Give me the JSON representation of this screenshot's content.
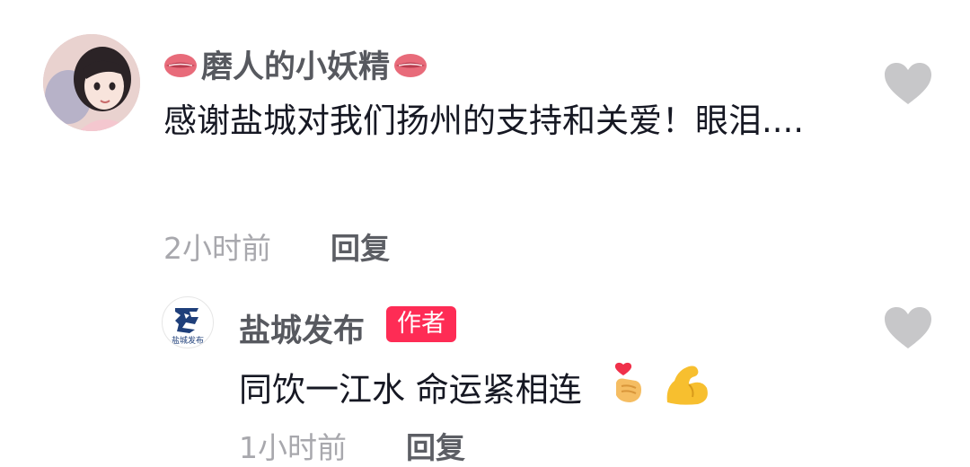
{
  "comments": [
    {
      "username": "磨人的小妖精",
      "text": "感谢盐城对我们扬州的支持和关爱！眼泪....",
      "time": "2小时前",
      "reply_label": "回复"
    }
  ],
  "replies": [
    {
      "username": "盐城发布",
      "badge": "作者",
      "avatar_text": "盐城发布",
      "text": "同饮一江水 命运紧相连",
      "time": "1小时前",
      "reply_label": "回复"
    }
  ],
  "colors": {
    "badge": "#fe2c55",
    "heart": "#c7c7c9",
    "muted": "#a8a8ad",
    "username": "#57595f"
  },
  "icons": [
    "kiss-icon",
    "heart-icon",
    "pinched-fingers-heart-emoji",
    "flexed-biceps-emoji"
  ]
}
